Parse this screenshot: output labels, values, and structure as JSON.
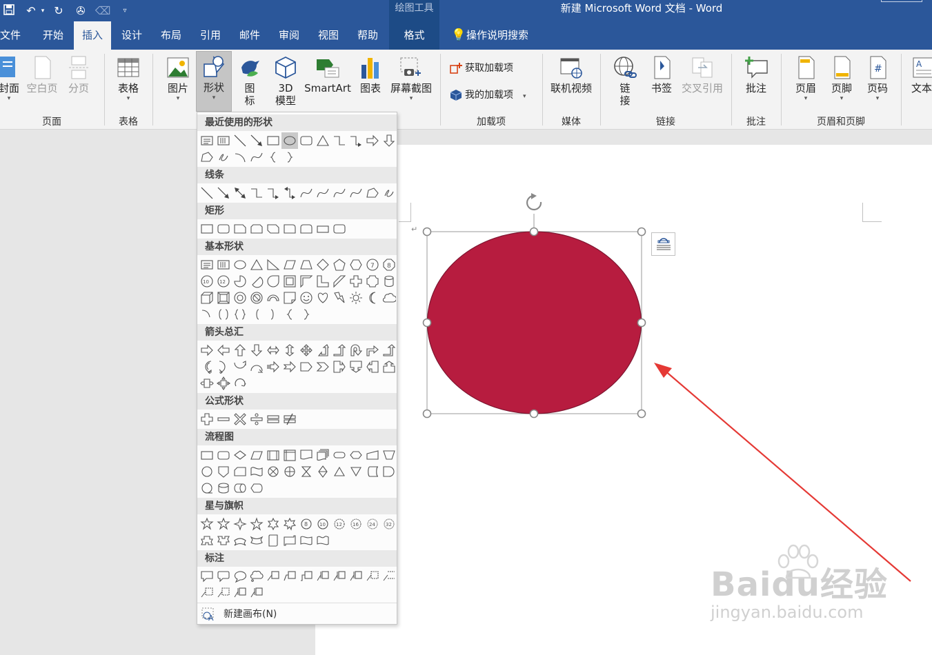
{
  "window": {
    "title": "新建 Microsoft Word 文档 - Word",
    "context_tools_label": "绘图工具"
  },
  "tabs": [
    {
      "label": "文件"
    },
    {
      "label": "开始"
    },
    {
      "label": "插入"
    },
    {
      "label": "设计"
    },
    {
      "label": "布局"
    },
    {
      "label": "引用"
    },
    {
      "label": "邮件"
    },
    {
      "label": "审阅"
    },
    {
      "label": "视图"
    },
    {
      "label": "帮助"
    },
    {
      "label": "格式"
    }
  ],
  "tell_me": "操作说明搜索",
  "ribbon": {
    "cover_page": "封面",
    "blank_page": "空白页",
    "page_break": "分页",
    "table": "表格",
    "pictures": "图片",
    "shapes": "形状",
    "icons_1": "图",
    "icons_2": "标",
    "model_1": "3D",
    "model_2": "模型",
    "smartart": "SmartArt",
    "chart": "图表",
    "screenshot": "屏幕截图",
    "get_addins": "获取加载项",
    "my_addins": "我的加载项",
    "online_video": "联机视频",
    "link_1": "链",
    "link_2": "接",
    "bookmark": "书签",
    "cross_ref": "交叉引用",
    "comment": "批注",
    "header": "页眉",
    "footer": "页脚",
    "page_number": "页码",
    "textbox": "文本",
    "groups": {
      "pages": "页面",
      "tables": "表格",
      "addins": "加载项",
      "media": "媒体",
      "links": "链接",
      "comments": "批注",
      "header_footer": "页眉和页脚"
    }
  },
  "shapes_menu": {
    "sections": {
      "recent": "最近使用的形状",
      "lines": "线条",
      "rectangles": "矩形",
      "basic": "基本形状",
      "arrows": "箭头总汇",
      "equation": "公式形状",
      "flowchart": "流程图",
      "stars": "星与旗帜",
      "callouts": "标注"
    },
    "new_canvas": "新建画布(N)"
  },
  "colors": {
    "ribbon_blue": "#2b579a",
    "shape_fill": "#b71c3f",
    "shape_stroke": "#7d1530",
    "arrow_red": "#e53935"
  },
  "watermark": {
    "main": "Baidu经验",
    "sub": "jingyan.baidu.com"
  }
}
